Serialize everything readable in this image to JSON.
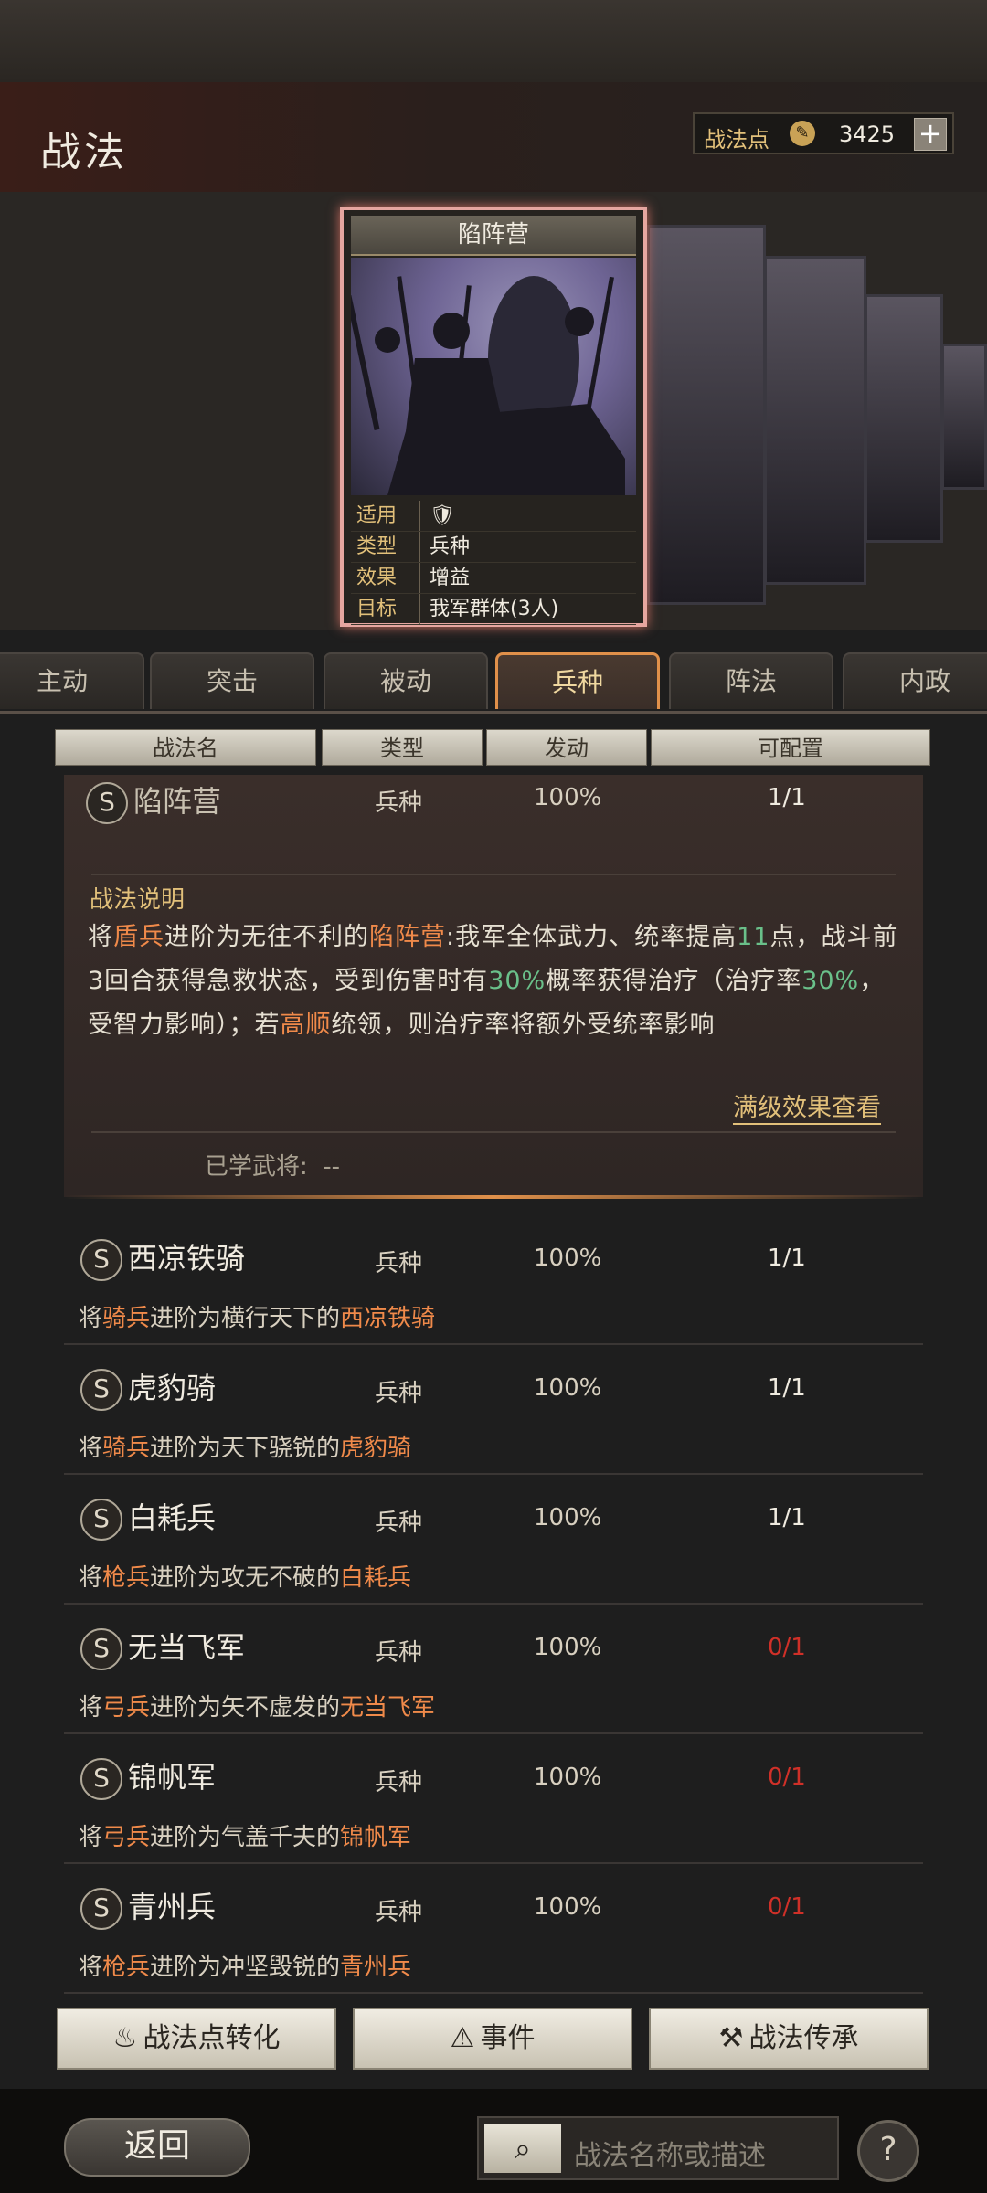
{
  "header": {
    "title": "战法",
    "points_label": "战法点",
    "points_value": "3425",
    "plus": "+"
  },
  "card": {
    "name": "陷阵营",
    "info": [
      {
        "k": "适用",
        "v": ""
      },
      {
        "k": "类型",
        "v": "兵种"
      },
      {
        "k": "效果",
        "v": "增益"
      },
      {
        "k": "目标",
        "v": "我军群体(3人)"
      }
    ]
  },
  "tabs": [
    "主动",
    "突击",
    "被动",
    "兵种",
    "阵法",
    "内政"
  ],
  "active_tab": "兵种",
  "columns": [
    "战法名",
    "类型",
    "发动",
    "可配置"
  ],
  "selected": {
    "badge": "S",
    "name": "陷阵营",
    "type": "兵种",
    "rate": "100%",
    "config": "1/1",
    "desc_title": "战法说明",
    "desc_parts": [
      "将",
      "盾兵",
      "进阶为无往不利的",
      "陷阵营",
      ":我军全体武力、统率提高",
      "11",
      "点，战斗前3回合获得急救状态，受到伤害时有",
      "30%",
      "概率获得治疗（治疗率",
      "30%",
      "，受智力影响）；若",
      "高顺",
      "统领，则治疗率将额外受统率影响"
    ],
    "max_link": "满级效果查看",
    "learned_label": "已学武将:",
    "learned_value": "--"
  },
  "rows": [
    {
      "badge": "S",
      "name": "西凉铁骑",
      "type": "兵种",
      "rate": "100%",
      "config": "1/1",
      "d1": "将",
      "d2": "骑兵",
      "d3": "进阶为横行天下的",
      "d4": "西凉铁骑"
    },
    {
      "badge": "S",
      "name": "虎豹骑",
      "type": "兵种",
      "rate": "100%",
      "config": "1/1",
      "d1": "将",
      "d2": "骑兵",
      "d3": "进阶为天下骁锐的",
      "d4": "虎豹骑"
    },
    {
      "badge": "S",
      "name": "白耗兵",
      "type": "兵种",
      "rate": "100%",
      "config": "1/1",
      "d1": "将",
      "d2": "枪兵",
      "d3": "进阶为攻无不破的",
      "d4": "白耗兵"
    },
    {
      "badge": "S",
      "name": "无当飞军",
      "type": "兵种",
      "rate": "100%",
      "config": "0/1",
      "d1": "将",
      "d2": "弓兵",
      "d3": "进阶为矢不虚发的",
      "d4": "无当飞军"
    },
    {
      "badge": "S",
      "name": "锦帆军",
      "type": "兵种",
      "rate": "100%",
      "config": "0/1",
      "d1": "将",
      "d2": "弓兵",
      "d3": "进阶为气盖千夫的",
      "d4": "锦帆军"
    },
    {
      "badge": "S",
      "name": "青州兵",
      "type": "兵种",
      "rate": "100%",
      "config": "0/1",
      "d1": "将",
      "d2": "枪兵",
      "d3": "进阶为冲坚毁锐的",
      "d4": "青州兵"
    }
  ],
  "buttons": {
    "convert": "战法点转化",
    "event": "事件",
    "inherit": "战法传承"
  },
  "footer": {
    "back": "返回",
    "search_placeholder": "战法名称或描述",
    "help": "?"
  },
  "colors": {
    "accent_orange": "#e0904a",
    "highlight_orange": "#f08a4a",
    "highlight_green": "#6ac08a",
    "red": "#d03028",
    "gold": "#e2c07a"
  }
}
